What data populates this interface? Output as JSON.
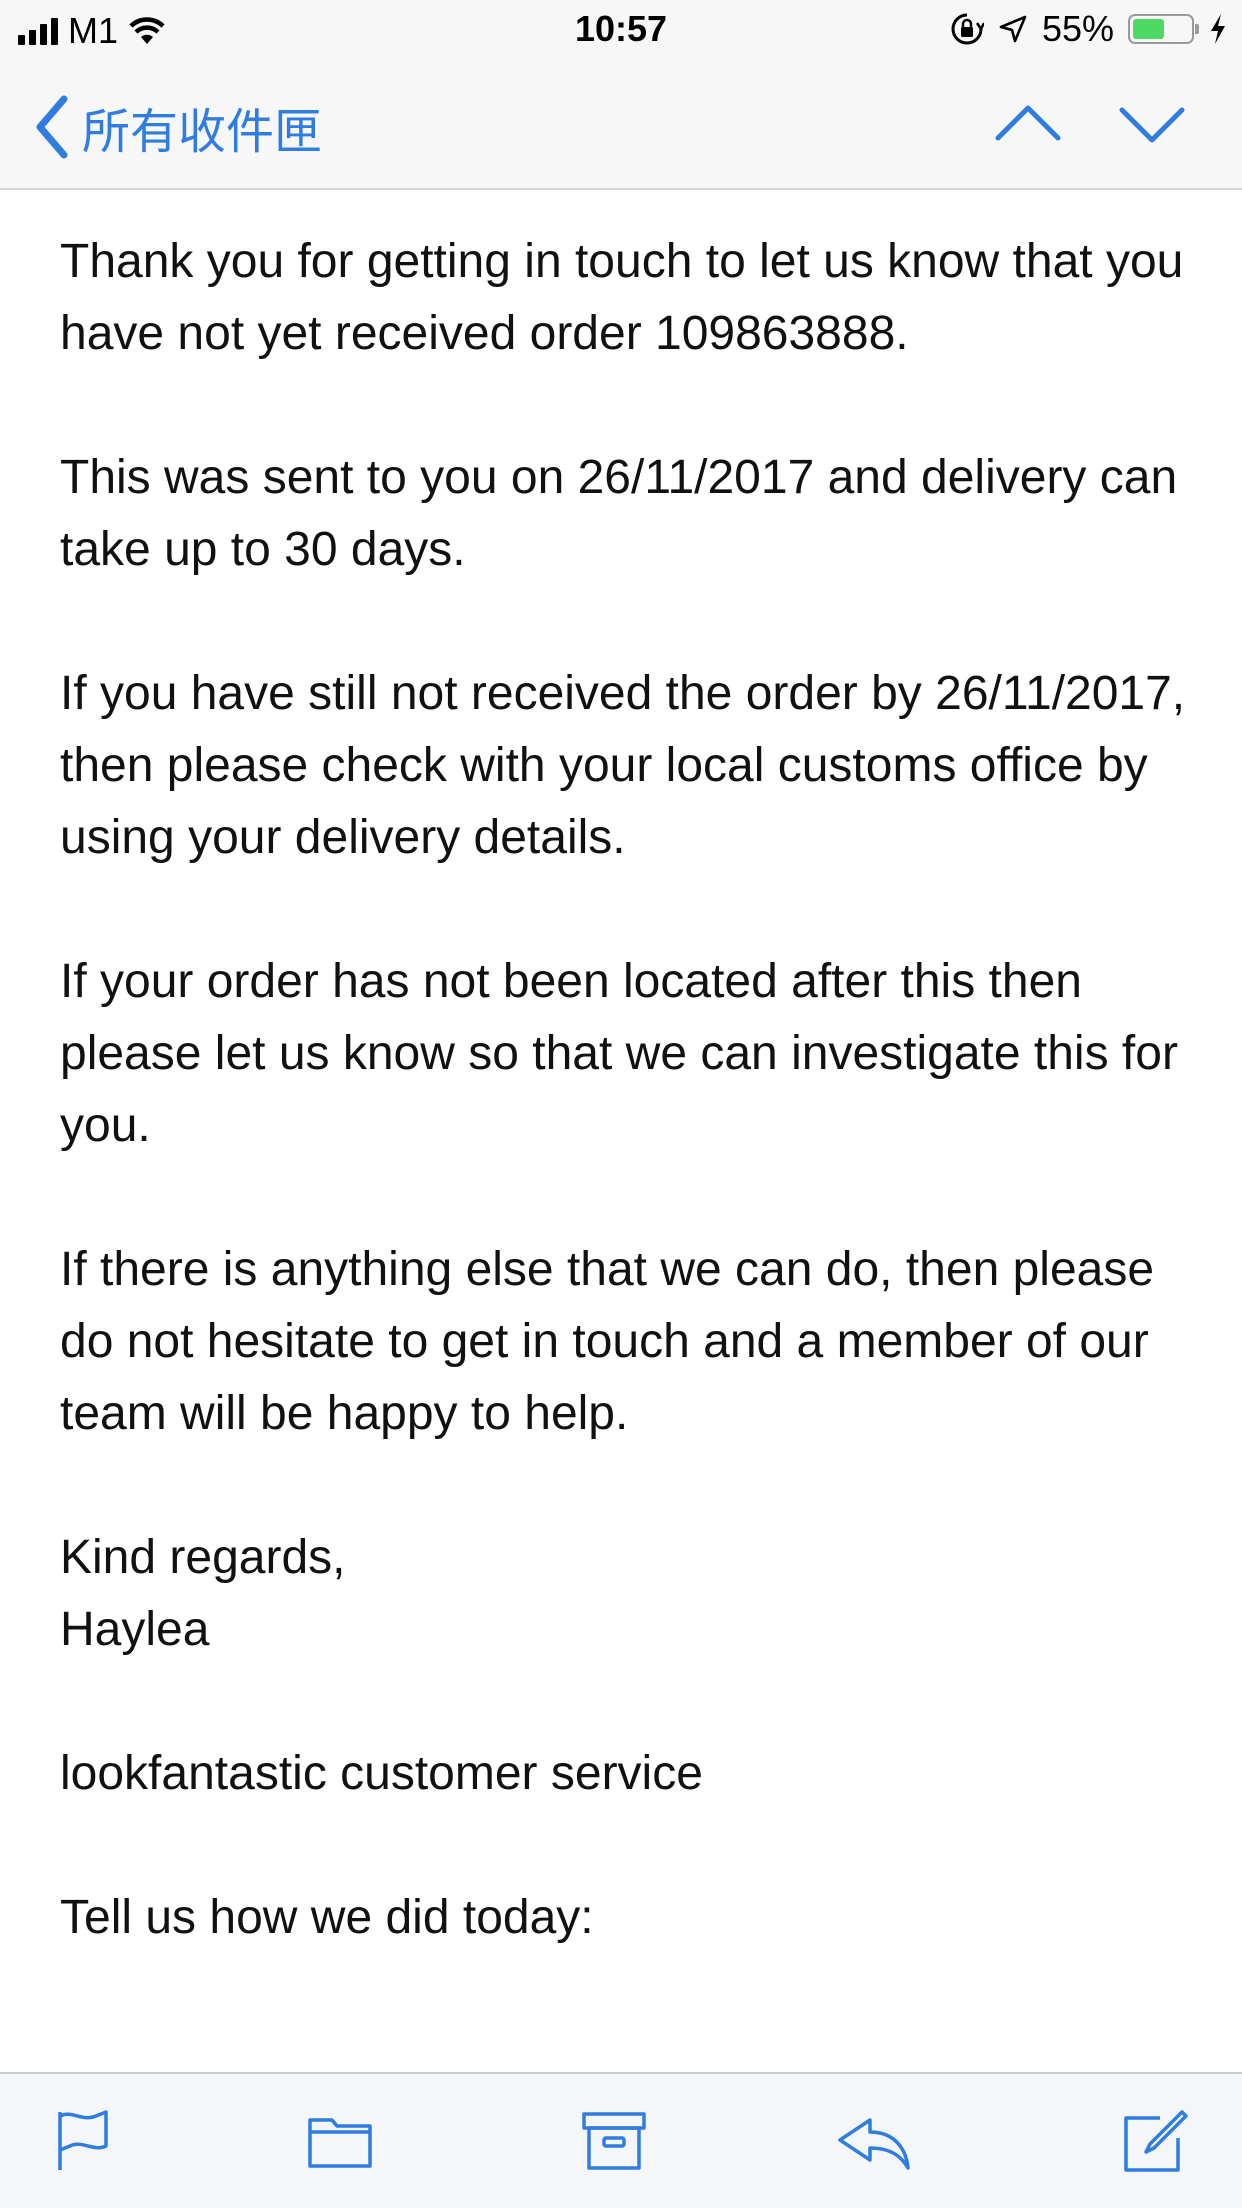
{
  "status_bar": {
    "carrier": "M1",
    "time": "10:57",
    "battery_percent_label": "55%",
    "battery_level": 0.55,
    "icons": [
      "signal-icon",
      "wifi-icon",
      "orientation-lock-icon",
      "location-icon",
      "battery-icon",
      "charging-icon"
    ]
  },
  "nav": {
    "back_label": "所有收件匣",
    "icons": [
      "chevron-left-icon",
      "chevron-up-icon",
      "chevron-down-icon"
    ]
  },
  "email": {
    "paragraphs": [
      "Thank you for getting in touch to let us know that you have not yet received order 109863888.",
      "This was sent to you on 26/11/2017 and delivery can take up to 30 days.",
      "If you have still not received the order by 26/11/2017, then please check with your local customs office by using your delivery details.",
      "If your order has not been located after this then please let us know so that we can investigate this for you.",
      "If there is anything else that we can do, then please do not hesitate to get in touch and a member of our team will be happy to help."
    ],
    "signoff": "Kind regards,",
    "signer": "Haylea",
    "company": "lookfantastic customer service",
    "survey_prompt": "Tell us how we did today:"
  },
  "toolbar": {
    "icons": [
      "flag-icon",
      "folder-icon",
      "archive-icon",
      "reply-icon",
      "compose-icon"
    ]
  },
  "colors": {
    "accent": "#2f7de1",
    "battery_fill": "#4cd964",
    "bar_background": "#f7f7f7"
  }
}
